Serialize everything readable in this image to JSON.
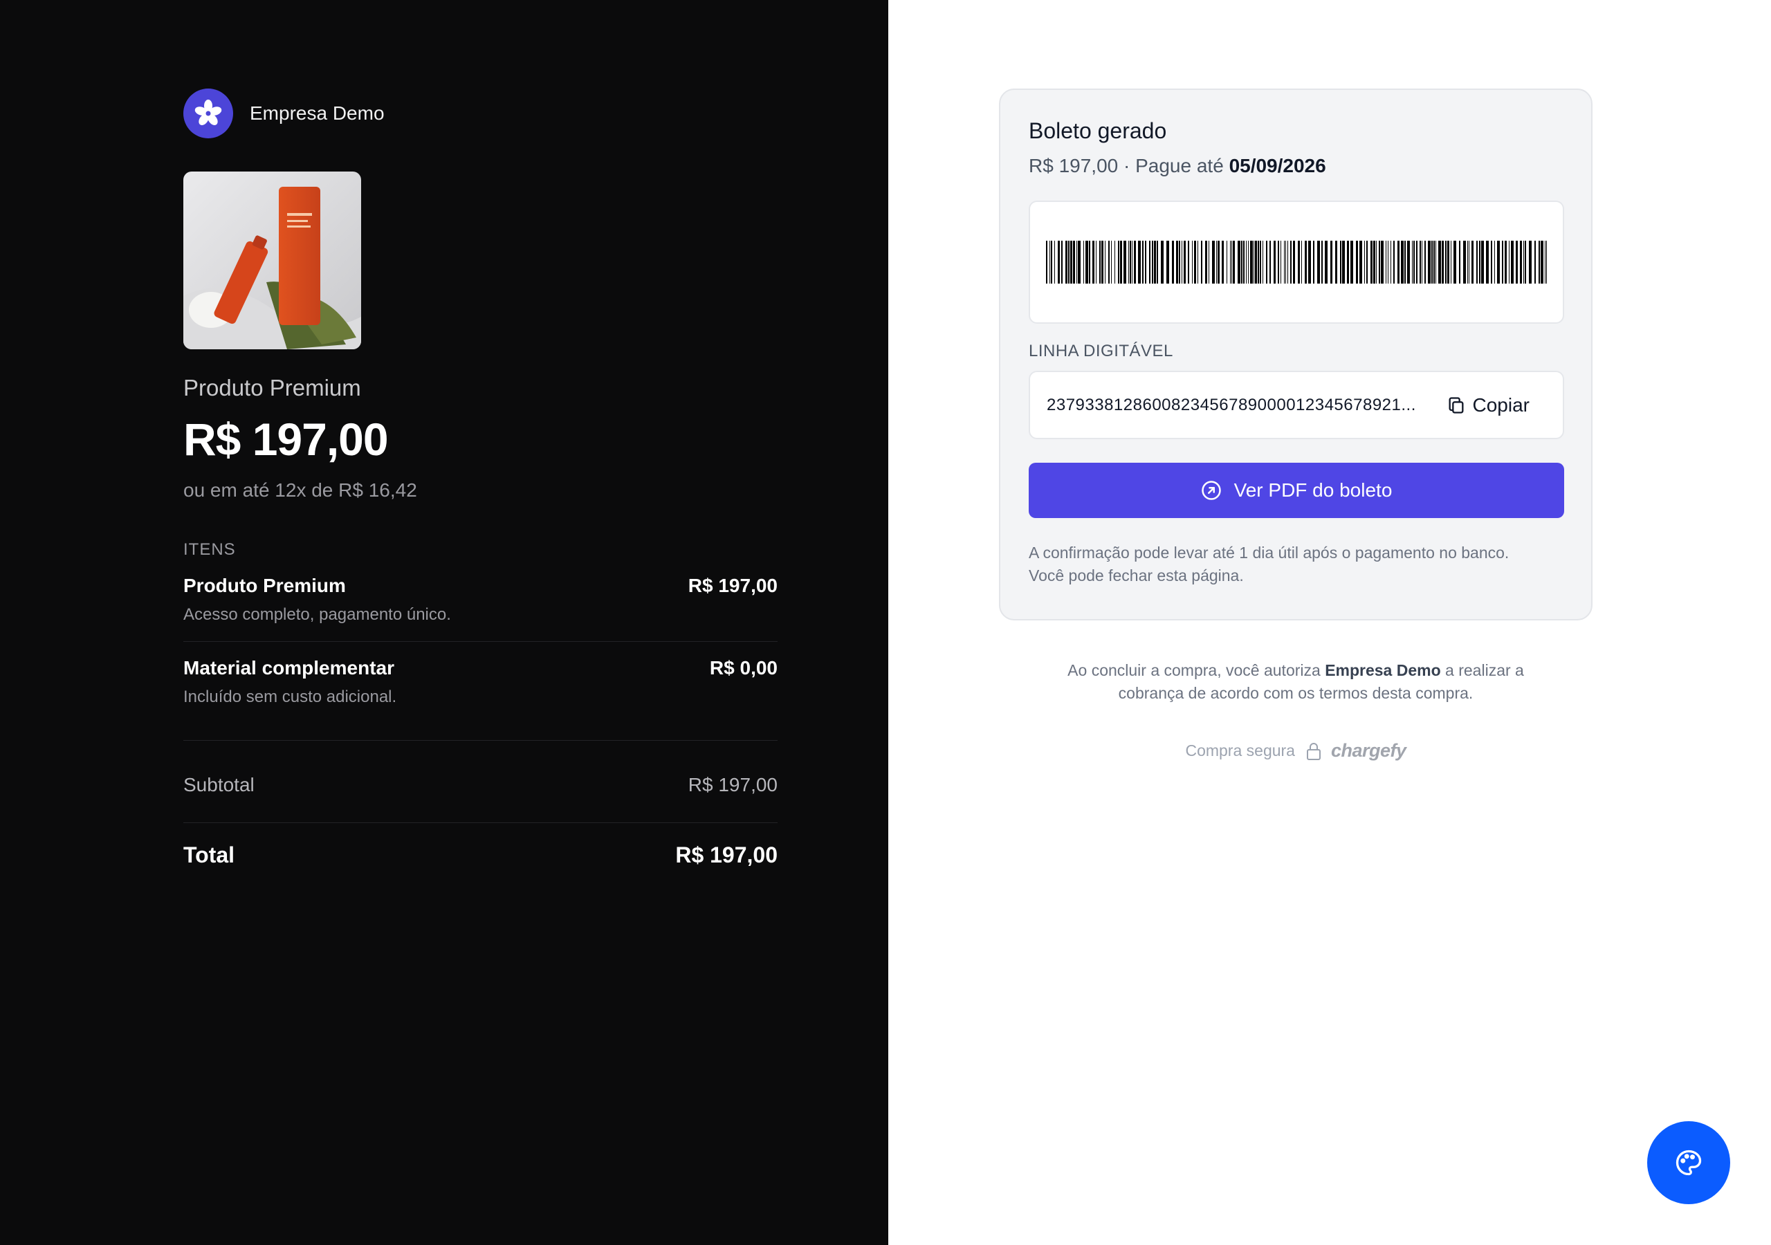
{
  "merchant": {
    "name": "Empresa Demo"
  },
  "product": {
    "title": "Produto Premium",
    "price": "R$ 197,00",
    "installments": "ou em até 12x de R$ 16,42",
    "image_alt": "product-photo"
  },
  "items": {
    "label": "ITENS",
    "list": [
      {
        "name": "Produto Premium",
        "description": "Acesso completo, pagamento único.",
        "price": "R$ 197,00"
      },
      {
        "name": "Material complementar",
        "description": "Incluído sem custo adicional.",
        "price": "R$ 0,00"
      }
    ]
  },
  "summary": {
    "subtotal_label": "Subtotal",
    "subtotal_value": "R$ 197,00",
    "total_label": "Total",
    "total_value": "R$ 197,00"
  },
  "boleto": {
    "title": "Boleto gerado",
    "amount": "R$ 197,00",
    "separator": " · ",
    "due_prefix": "Pague até ",
    "due_date": "05/09/2026",
    "line_label": "LINHA DIGITÁVEL",
    "line_code": "2379338128600823456789000012345678921...",
    "copy_label": "Copiar",
    "pdf_label": "Ver PDF do boleto",
    "note_line1": "A confirmação pode levar até 1 dia útil após o pagamento no banco.",
    "note_line2": "Você pode fechar esta página."
  },
  "consent": {
    "before": "Ao concluir a compra, você autoriza ",
    "merchant": "Empresa Demo",
    "after_line1": " a realizar a",
    "line2": "cobrança de acordo com os termos desta compra."
  },
  "footer": {
    "secure_label": "Compra segura",
    "provider": "chargefy"
  },
  "colors": {
    "dark_bg": "#0b0b0c",
    "accent": "#4f46e5",
    "fab": "#0b5cff",
    "logo": "#4c45d8"
  },
  "icons": {
    "logo": "flower-icon",
    "copy": "copy-icon",
    "pdf": "arrow-up-right-circle-icon",
    "lock": "lock-icon",
    "fab": "palette-icon"
  }
}
